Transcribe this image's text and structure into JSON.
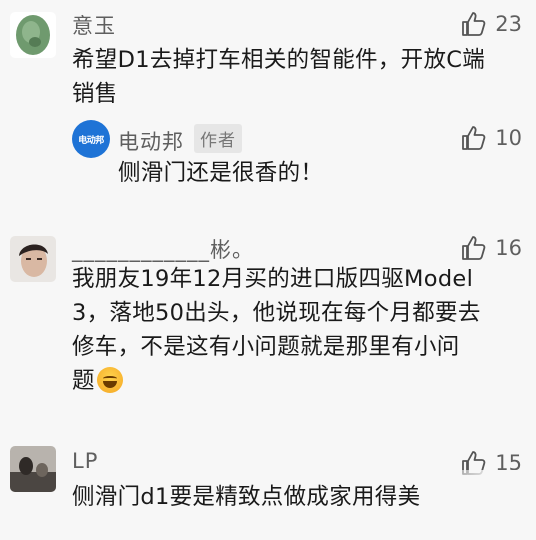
{
  "comments": [
    {
      "username": "意玉",
      "likes": "23",
      "lines": [
        "希望D1去掉打车相关的智能件，开放C端",
        "销售"
      ],
      "reply": {
        "username": "电动邦",
        "tag": "作者",
        "avatar_text": "电动邦",
        "likes": "10",
        "text": "侧滑门还是很香的！"
      }
    },
    {
      "username": "____________彬。",
      "likes": "16",
      "lines": [
        "我朋友19年12月买的进口版四驱Model",
        "3，落地50出头，他说现在每个月都要去",
        "修车，不是这有小问题就是那里有小问",
        "题"
      ]
    },
    {
      "username": "LP",
      "likes": "15",
      "lines": [
        "侧滑门d1要是精致点做成家用得美"
      ]
    }
  ],
  "icons": {
    "like": "thumbs-up-icon",
    "emoji": "laughing-tears-emoji"
  }
}
